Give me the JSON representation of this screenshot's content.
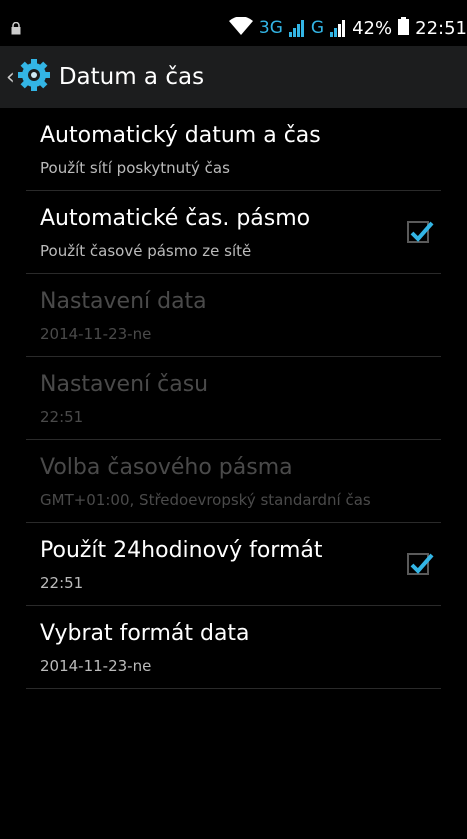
{
  "status_bar": {
    "network_3g": "3G",
    "network_g": "G",
    "battery": "42%",
    "time": "22:51",
    "icons": [
      "lock-icon",
      "wifi-icon",
      "signal-icon",
      "battery-icon"
    ]
  },
  "action_bar": {
    "title": "Datum a čas",
    "icons": [
      "back-chevron-icon",
      "settings-gear-icon"
    ]
  },
  "settings": [
    {
      "title": "Automatický datum a čas",
      "subtitle": "Použít sítí poskytnutý čas",
      "enabled": true,
      "checkbox": null
    },
    {
      "title": "Automatické čas. pásmo",
      "subtitle": "Použít časové pásmo ze sítě",
      "enabled": true,
      "checkbox": true
    },
    {
      "title": "Nastavení data",
      "subtitle": "2014-11-23-ne",
      "enabled": false,
      "checkbox": null
    },
    {
      "title": "Nastavení času",
      "subtitle": "22:51",
      "enabled": false,
      "checkbox": null
    },
    {
      "title": "Volba časového pásma",
      "subtitle": "GMT+01:00, Středoevropský standardní čas",
      "enabled": false,
      "checkbox": null
    },
    {
      "title": "Použít 24hodinový formát",
      "subtitle": "22:51",
      "enabled": true,
      "checkbox": true
    },
    {
      "title": "Vybrat formát data",
      "subtitle": "2014-11-23-ne",
      "enabled": true,
      "checkbox": null
    }
  ],
  "colors": {
    "accent": "#33b5e5",
    "background": "#000000",
    "action_bar": "#1c1d1e",
    "disabled_text": "#4a4a4a"
  }
}
